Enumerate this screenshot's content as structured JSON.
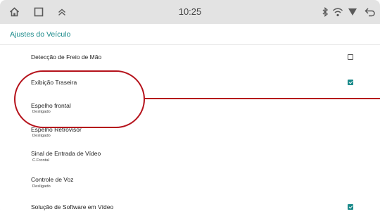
{
  "status_bar": {
    "time": "10:25",
    "left_icons": [
      "home-icon",
      "recent-apps-icon",
      "chevron-up-icon"
    ],
    "right_icons": [
      "bluetooth-icon",
      "wifi-icon",
      "signal-icon",
      "back-icon"
    ]
  },
  "app_bar": {
    "title": "Ajustes do Veículo"
  },
  "settings": [
    {
      "title": "Detecção de Freio de Mão",
      "checkbox": true,
      "checked": false
    },
    {
      "title": "Exibição Traseira",
      "checkbox": true,
      "checked": true
    },
    {
      "title": "Espelho frontal",
      "subtitle": "Desligado"
    },
    {
      "title": "Espelho Retrovisor",
      "subtitle": "Desligado"
    },
    {
      "title": "Sinal de Entrada de Vídeo",
      "subtitle": "C.Frontal"
    },
    {
      "title": "Controle de Voz",
      "subtitle": "Desligado"
    },
    {
      "title": "Solução de Software em Vídeo",
      "checkbox": true,
      "checked": true
    }
  ],
  "colors": {
    "accent": "#1a8a8a",
    "callout": "#b5121b",
    "status_bar_bg": "#e3e3e3"
  }
}
